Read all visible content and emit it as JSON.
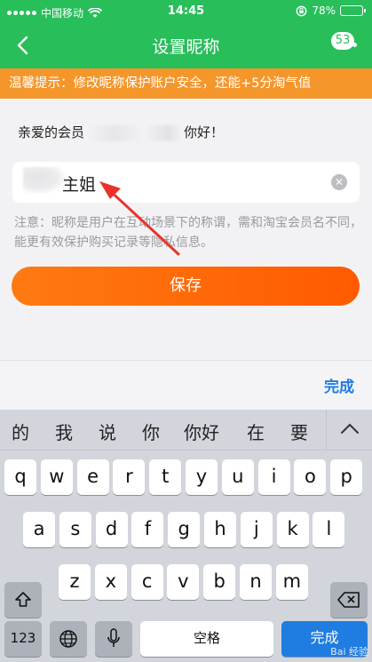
{
  "status_bar": {
    "carrier": "中国移动",
    "time": "14:45",
    "battery": "78%",
    "battery_level": 0.78
  },
  "nav": {
    "title": "设置昵称",
    "badge": "53"
  },
  "notice": {
    "text": "温馨提示：修改昵称保护账户安全，还能+5分淘气值"
  },
  "greeting": {
    "prefix": "亲爱的会员",
    "suffix": "你好！"
  },
  "nickname": {
    "value": "主姐"
  },
  "hint": {
    "text": "注意：昵称是用户在互动场景下的称谓，需和淘宝会员名不同，能更有效保护购买记录等隐私信息。"
  },
  "save_button": {
    "label": "保存"
  },
  "keyboard": {
    "done_label": "完成",
    "candidates": [
      "的",
      "我",
      "说",
      "你",
      "你好",
      "在",
      "要"
    ],
    "row1": [
      "q",
      "w",
      "e",
      "r",
      "t",
      "y",
      "u",
      "i",
      "o",
      "p"
    ],
    "row2": [
      "a",
      "s",
      "d",
      "f",
      "g",
      "h",
      "j",
      "k",
      "l"
    ],
    "row3": [
      "z",
      "x",
      "c",
      "v",
      "b",
      "n",
      "m"
    ],
    "numbers_label": "123",
    "space_label": "空格",
    "confirm_label": "完成"
  },
  "watermark": "Bai 经验"
}
